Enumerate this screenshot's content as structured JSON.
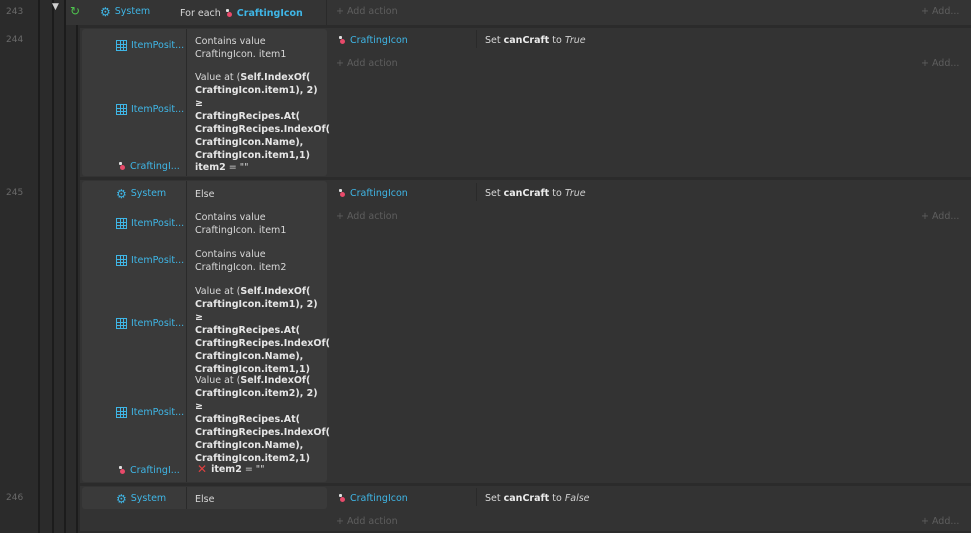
{
  "line_numbers": [
    "243",
    "244",
    "245",
    "246"
  ],
  "add_action": "+ Add action",
  "add_short": "+ Add...",
  "foreach_row": {
    "object": "System",
    "text_prefix": "For each",
    "target": "CraftingIcon"
  },
  "event244": {
    "conditions": [
      {
        "object": "ItemPosit...",
        "text": "Contains value CraftingIcon. item1"
      },
      {
        "object": "ItemPosit...",
        "text_prefix": "Value at (",
        "bold_lines": [
          "Self.IndexOf(",
          "CraftingIcon.item1), 2) ≥",
          "CraftingRecipes.At(",
          "CraftingRecipes.IndexOf(",
          "CraftingIcon.Name),",
          "CraftingIcon.item1,1)"
        ]
      },
      {
        "object": "CraftingI...",
        "bold": "item2",
        "text_suffix": " = \"\""
      }
    ],
    "action": {
      "object": "CraftingIcon",
      "prefix": "Set",
      "var": "canCraft",
      "mid": "to",
      "value": "True"
    }
  },
  "event245": {
    "conditions": [
      {
        "object": "System",
        "text": "Else"
      },
      {
        "object": "ItemPosit...",
        "text": "Contains value CraftingIcon. item1"
      },
      {
        "object": "ItemPosit...",
        "text": "Contains value CraftingIcon. item2"
      },
      {
        "object": "ItemPosit...",
        "text_prefix": "Value at (",
        "bold_lines": [
          "Self.IndexOf(",
          "CraftingIcon.item1), 2) ≥",
          "CraftingRecipes.At(",
          "CraftingRecipes.IndexOf(",
          "CraftingIcon.Name),",
          "CraftingIcon.item1,1)"
        ]
      },
      {
        "object": "ItemPosit...",
        "text_prefix": "Value at (",
        "bold_lines": [
          "Self.IndexOf(",
          "CraftingIcon.item2), 2) ≥",
          "CraftingRecipes.At(",
          "CraftingRecipes.IndexOf(",
          "CraftingIcon.Name),",
          "CraftingIcon.item2,1)"
        ]
      },
      {
        "object": "CraftingI...",
        "bold": "item2",
        "text_suffix": " = \"\"",
        "inverted": true
      }
    ],
    "action": {
      "object": "CraftingIcon",
      "prefix": "Set",
      "var": "canCraft",
      "mid": "to",
      "value": "True"
    }
  },
  "event246": {
    "conditions": [
      {
        "object": "System",
        "text": "Else"
      }
    ],
    "action": {
      "object": "CraftingIcon",
      "prefix": "Set",
      "var": "canCraft",
      "mid": "to",
      "value": "False"
    }
  },
  "colors": {
    "accent": "#3fb6e6",
    "background": "#2b2b2b",
    "row": "#333333",
    "condition_bg": "#3a3a3a",
    "invert": "#e04040"
  }
}
